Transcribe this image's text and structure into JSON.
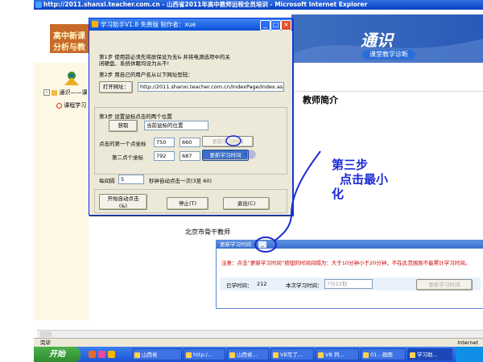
{
  "browser": {
    "title": "http://2011.shanxi.teacher.com.cn - 山西省2011年高中教师远程全员培训 - Microsoft Internet Explorer",
    "status": "完毕",
    "zone": "Internet"
  },
  "banner": {
    "left_line1": "高中新课",
    "left_line2": "分析与教",
    "right_big": "通识",
    "right_small": "课堂教学诊断"
  },
  "nav": {
    "item1": "通识——课",
    "item2": "课程学习"
  },
  "content": {
    "title": "教师简介",
    "beijing": "北京市骨干教师"
  },
  "helper": {
    "title": "学习助手V1.8 免费版 制作者：xue",
    "step1": "第1步 使用前必须先将屏保设为无&  并将电源选项中的关",
    "step1b": "闭硬盘、系统休眠均设为从不!",
    "step2": "第2步 用自己的用户名从以下网址登陆：",
    "open_url": "打开网址：",
    "url": "http://2011.shanxi.teacher.com.cn/IndexPage/Index.aspx",
    "step3": "第3步 设置鼠标点击的两个位置",
    "get_btn": "获取",
    "get_value": "当前鼠标的位置",
    "coord1_label": "点击的第一个点坐标",
    "coord1_x": "750",
    "coord1_y": "660",
    "coord2_label": "第二点个坐标",
    "coord2_x": "792",
    "coord2_y": "687",
    "preview1": "更新学习时间",
    "preview2": "更新学习时间",
    "interval_label": "每间隔",
    "interval_value": "5",
    "interval_unit": "秒钟自动点击一次(3至 60)",
    "btn_start_1": "开始自动点击",
    "btn_start_2": "(&)",
    "btn_stop": "停止(T)",
    "btn_exit": "退出(C)"
  },
  "popup": {
    "title": "更新学习时间",
    "note": "注意：点击“更新学习时间”按钮的时间间隔为：大于10分钟小于20分钟，不在此范围则不能累计学习时间。",
    "studied_label": "已学时间：",
    "studied_value": "212",
    "this_label": "本次学习时间：",
    "this_value": "7分22秒",
    "update_btn": "更新学习时间"
  },
  "annotation": {
    "line1": "第三步",
    "line2": "点击最小",
    "line3": "化"
  },
  "taskbar": {
    "start": "开始",
    "items": [
      "山西省",
      "http:/...",
      "山西省...",
      "VB写了...",
      "VB 判...",
      "01 - 画图",
      "学习助..."
    ]
  },
  "colors": {
    "annotation_blue": "#1a2ad6",
    "title_blue": "#0a4fd6",
    "note_red": "#cc0000"
  }
}
